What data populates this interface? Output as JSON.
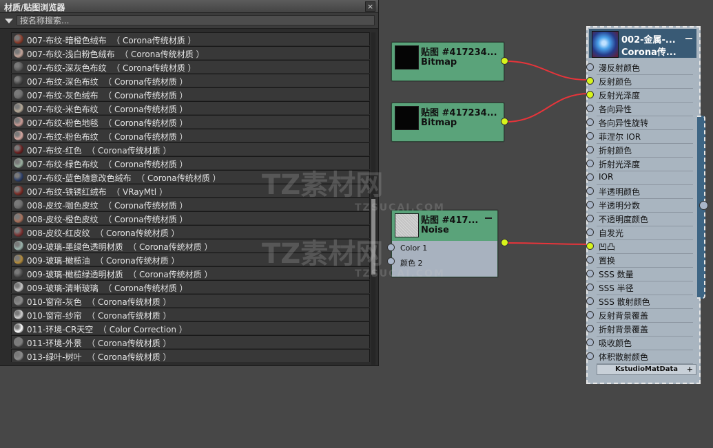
{
  "browser": {
    "title": "材质/贴图浏览器",
    "close_glyph": "×",
    "search_placeholder": "按名称搜索...",
    "items": [
      {
        "label": "007-布纹-暗橙色绒布  （ Corona传统材质 ）",
        "swatch": "#8a3b2a"
      },
      {
        "label": "007-布纹-浅白粉色绒布  （ Corona传统材质 ）",
        "swatch": "#c4a59a"
      },
      {
        "label": "007-布纹-深灰色布纹  （ Corona传统材质 ）",
        "swatch": "#5a5a5a"
      },
      {
        "label": "007-布纹-深色布纹  （ Corona传统材质 ）",
        "swatch": "#444444"
      },
      {
        "label": "007-布纹-灰色绒布  （ Corona传统材质 ）",
        "swatch": "#6c6c6c"
      },
      {
        "label": "007-布纹-米色布纹  （ Corona传统材质 ）",
        "swatch": "#b7aa98"
      },
      {
        "label": "007-布纹-粉色地毯  （ Corona传统材质 ）",
        "swatch": "#c99a94"
      },
      {
        "label": "007-布纹-粉色布纹  （ Corona传统材质 ）",
        "swatch": "#d6a7a0"
      },
      {
        "label": "007-布纹-红色  （ Corona传统材质 ）",
        "swatch": "#6a1f1f"
      },
      {
        "label": "007-布纹-绿色布纹  （ Corona传统材质 ）",
        "swatch": "#9ab0a0"
      },
      {
        "label": "007-布纹-蓝色随意改色绒布  （ Corona传统材质 ）",
        "swatch": "#2c3f6a"
      },
      {
        "label": "007-布纹-铁锈红绒布  （ VRayMtl ）",
        "swatch": "#7a2a24"
      },
      {
        "label": "008-皮纹-咖色皮纹  （ Corona传统材质 ）",
        "swatch": "#6a6a6a"
      },
      {
        "label": "008-皮纹-橙色皮纹  （ Corona传统材质 ）",
        "swatch": "#a8705a"
      },
      {
        "label": "008-皮纹-红皮纹  （ Corona传统材质 ）",
        "swatch": "#7a3030"
      },
      {
        "label": "009-玻璃-墨绿色透明材质  （ Corona传统材质 ）",
        "swatch": "#9bb5ad"
      },
      {
        "label": "009-玻璃-橄榄油  （ Corona传统材质 ）",
        "swatch": "#b28a3a"
      },
      {
        "label": "009-玻璃-橄榄绿透明材质  （ Corona传统材质 ）",
        "swatch": "#4a4a4a"
      },
      {
        "label": "009-玻璃-清晰玻璃  （ Corona传统材质 ）",
        "swatch": "#c7c7c7"
      },
      {
        "label": "010-窗帘-灰色  （ Corona传统材质 ）",
        "swatch": "#8a8a8a"
      },
      {
        "label": "010-窗帘-纱帘  （ Corona传统材质 ）",
        "swatch": "#d0d0d0"
      },
      {
        "label": "011-环境-CR天空  （ Color Correction ）",
        "swatch": "#ffffff"
      },
      {
        "label": "011-环境-外景  （ Corona传统材质 ）",
        "swatch": "#7c7c7c"
      },
      {
        "label": "013-绿叶-树叶  （ Corona传统材质 ）",
        "swatch": "#8c8c8c"
      }
    ]
  },
  "nodes": {
    "bitmap1": {
      "title": "贴图 #417234...",
      "type": "Bitmap"
    },
    "bitmap2": {
      "title": "贴图 #417234...",
      "type": "Bitmap"
    },
    "noise": {
      "title": "贴图 #417...",
      "type": "Noise",
      "input1": "Color 1",
      "input2": "颜色 2"
    }
  },
  "material": {
    "title": "002-金属-...",
    "subtitle": "Corona传...",
    "slots": [
      "漫反射颜色",
      "反射颜色",
      "反射光泽度",
      "各向异性",
      "各向异性旋转",
      "菲涅尔 IOR",
      "折射颜色",
      "折射光泽度",
      "IOR",
      "半透明颜色",
      "半透明分数",
      "不透明度颜色",
      "自发光",
      "凹凸",
      "置换",
      "SSS 数量",
      "SSS 半径",
      "SSS 散射颜色",
      "反射背景覆盖",
      "折射背景覆盖",
      "吸收颜色",
      "体积散射颜色"
    ],
    "connected_slots": [
      1,
      2,
      13
    ],
    "footer": "KstudioMatData",
    "footer_plus": "+"
  },
  "colors": {
    "node_green": "#5aa37a",
    "port_active": "#d7f41b",
    "wire": "#e8343a",
    "material_header": "#395a75"
  },
  "watermark": {
    "brand": "TZ素材网",
    "site": "TZSUCAI.COM"
  }
}
